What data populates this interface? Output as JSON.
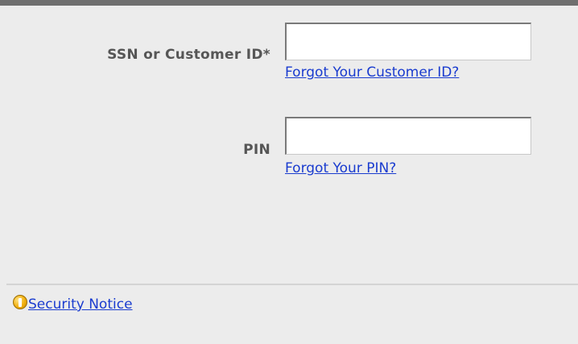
{
  "login_form": {
    "ssn_label": "SSN or Customer ID*",
    "ssn_value": "",
    "forgot_customer_id_link": "Forgot Your Customer ID?",
    "pin_label": "PIN",
    "pin_value": "",
    "forgot_pin_link": "Forgot Your PIN?"
  },
  "footer": {
    "notice_icon": "warning-exclamation-icon",
    "security_notice_link": "Security Notice"
  },
  "colors": {
    "background": "#ececec",
    "top_bar": "#6f6f6f",
    "link": "#1a3ccf",
    "label_text": "#565656",
    "icon": "#f2b00e"
  }
}
